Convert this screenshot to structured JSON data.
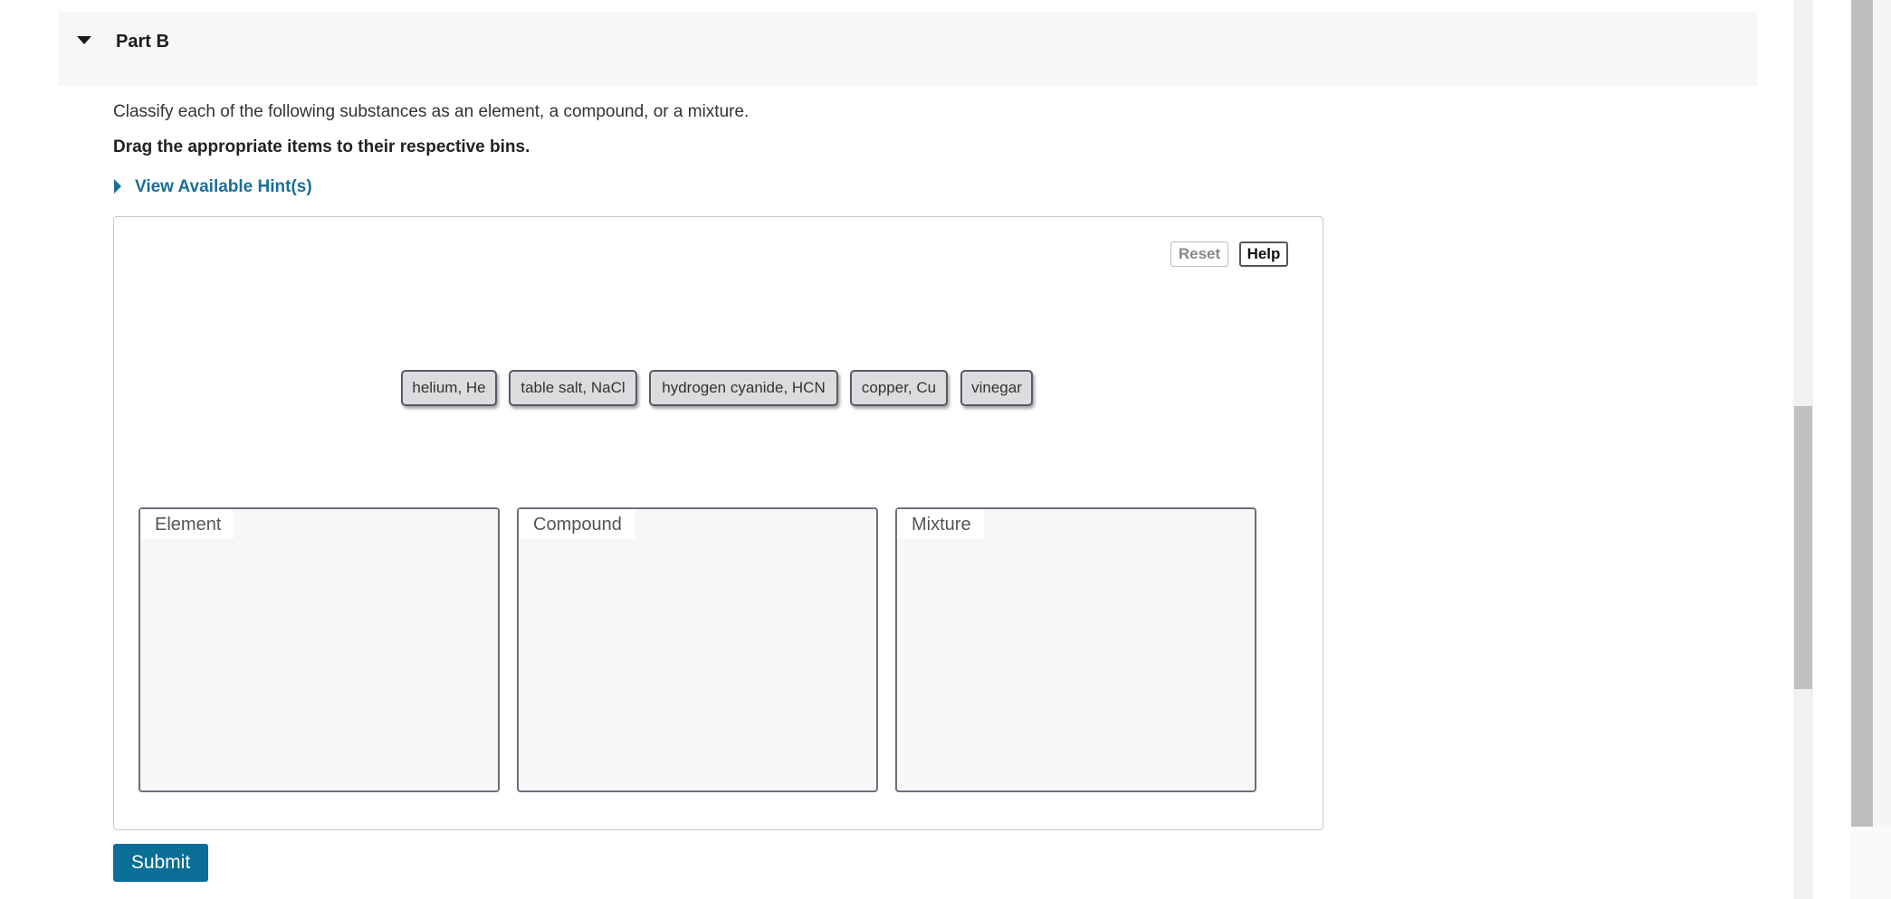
{
  "part": {
    "title": "Part B"
  },
  "question": {
    "text": "Classify each of the following substances as an element, a compound, or a mixture.",
    "instruction": "Drag the appropriate items to their respective bins.",
    "hint_link": "View Available Hint(s)"
  },
  "toolbar": {
    "reset_label": "Reset",
    "help_label": "Help"
  },
  "items": [
    {
      "label": "helium, He"
    },
    {
      "label": "table salt, NaCl"
    },
    {
      "label": "hydrogen cyanide, HCN"
    },
    {
      "label": "copper, Cu"
    },
    {
      "label": "vinegar"
    }
  ],
  "bins": [
    {
      "label": "Element"
    },
    {
      "label": "Compound"
    },
    {
      "label": "Mixture"
    }
  ],
  "submit_label": "Submit",
  "colors": {
    "accent": "#0b6e96",
    "link": "#1a6e99",
    "chip_bg": "#dcdcde",
    "bin_bg": "#f7f7f7"
  }
}
